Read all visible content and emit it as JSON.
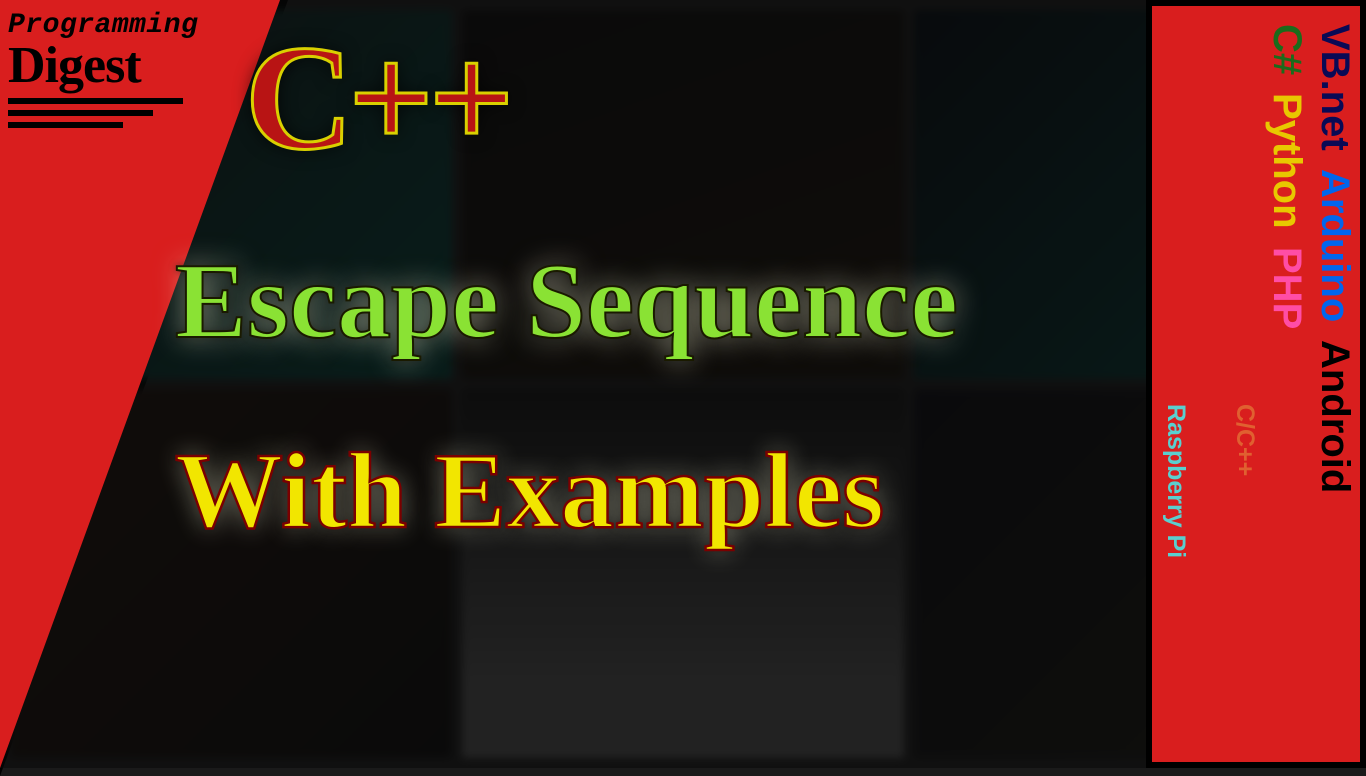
{
  "logo": {
    "line1": "Programming",
    "line2": "Digest"
  },
  "title_cpp": "C++",
  "title_main": "Escape Sequence",
  "title_sub": "With Examples",
  "right_band": {
    "large": [
      {
        "label": "VB.net",
        "cls": "t-vbnet"
      },
      {
        "label": "Arduino",
        "cls": "t-arduino"
      },
      {
        "label": "Android",
        "cls": "t-android"
      },
      {
        "label": "C#",
        "cls": "t-csharp"
      },
      {
        "label": "Python",
        "cls": "t-python"
      },
      {
        "label": "PHP",
        "cls": "t-php"
      }
    ],
    "small": [
      {
        "label": "C/C++",
        "cls": "t-ccpp"
      },
      {
        "label": "Raspberry Pi",
        "cls": "t-rpi"
      }
    ]
  }
}
